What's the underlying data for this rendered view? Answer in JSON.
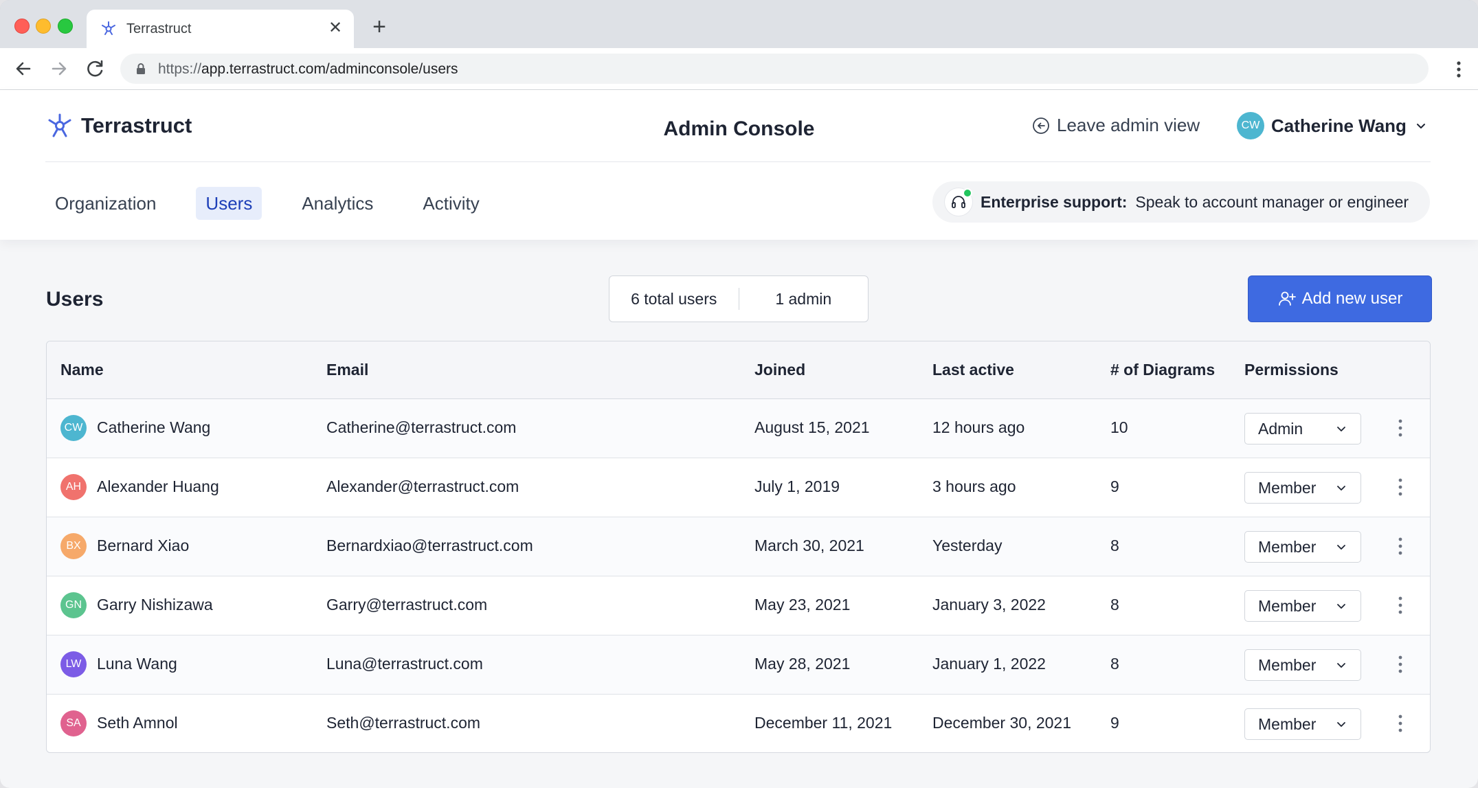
{
  "browser": {
    "tab_title": "Terrastruct",
    "url_scheme": "https://",
    "url_rest": "app.terrastruct.com/adminconsole/users"
  },
  "header": {
    "brand": "Terrastruct",
    "page_title": "Admin Console",
    "leave_admin": "Leave admin view",
    "current_user": {
      "initials": "CW",
      "name": "Catherine Wang",
      "color": "#4db6d0"
    }
  },
  "nav": {
    "tabs": [
      {
        "label": "Organization",
        "active": false
      },
      {
        "label": "Users",
        "active": true
      },
      {
        "label": "Analytics",
        "active": false
      },
      {
        "label": "Activity",
        "active": false
      }
    ]
  },
  "support": {
    "label": "Enterprise support:",
    "text": "Speak to account manager or engineer"
  },
  "users_section": {
    "title": "Users",
    "total_users": "6 total users",
    "admins": "1 admin",
    "add_button": "Add new user"
  },
  "table": {
    "columns": [
      "Name",
      "Email",
      "Joined",
      "Last active",
      "# of Diagrams",
      "Permissions"
    ],
    "rows": [
      {
        "initials": "CW",
        "color": "#4db6d0",
        "name": "Catherine Wang",
        "email": "Catherine@terrastruct.com",
        "joined": "August 15, 2021",
        "last_active": "12 hours ago",
        "diagrams": "10",
        "permission": "Admin"
      },
      {
        "initials": "AH",
        "color": "#f0726d",
        "name": "Alexander Huang",
        "email": "Alexander@terrastruct.com",
        "joined": "July 1, 2019",
        "last_active": "3 hours ago",
        "diagrams": "9",
        "permission": "Member"
      },
      {
        "initials": "BX",
        "color": "#f6a96a",
        "name": "Bernard Xiao",
        "email": "Bernardxiao@terrastruct.com",
        "joined": "March 30, 2021",
        "last_active": "Yesterday",
        "diagrams": "8",
        "permission": "Member"
      },
      {
        "initials": "GN",
        "color": "#5cc48f",
        "name": "Garry Nishizawa",
        "email": "Garry@terrastruct.com",
        "joined": "May 23, 2021",
        "last_active": "January 3, 2022",
        "diagrams": "8",
        "permission": "Member"
      },
      {
        "initials": "LW",
        "color": "#7c5ce6",
        "name": "Luna Wang",
        "email": "Luna@terrastruct.com",
        "joined": "May 28, 2021",
        "last_active": "January 1, 2022",
        "diagrams": "8",
        "permission": "Member"
      },
      {
        "initials": "SA",
        "color": "#e0628f",
        "name": "Seth Amnol",
        "email": "Seth@terrastruct.com",
        "joined": "December 11, 2021",
        "last_active": "December 30, 2021",
        "diagrams": "9",
        "permission": "Member"
      }
    ]
  },
  "colors": {
    "accent": "#3e6ae1",
    "active_tab_bg": "#e7edfb",
    "active_tab_text": "#1d3fb8",
    "online_dot": "#22c55e"
  },
  "icons": [
    "terrastruct-logo-icon",
    "back-arrow-icon",
    "forward-arrow-icon",
    "reload-icon",
    "lock-icon",
    "browser-menu-icon",
    "leave-icon",
    "chevron-down-icon",
    "headset-icon",
    "add-user-icon",
    "more-vertical-icon"
  ]
}
